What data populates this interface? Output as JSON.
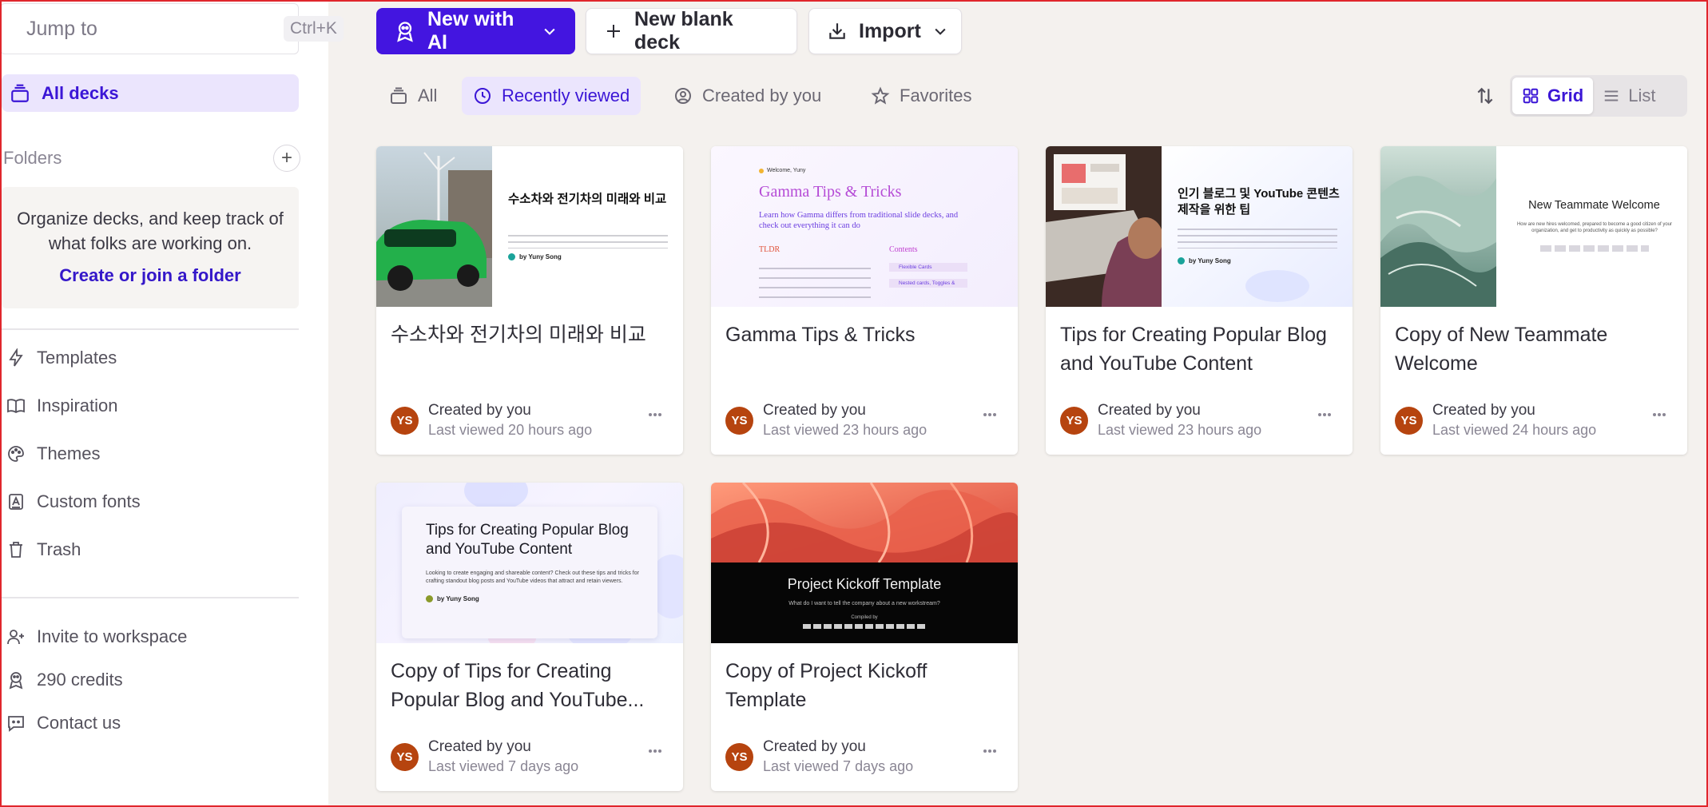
{
  "sidebar": {
    "search": {
      "placeholder": "Jump to",
      "shortcut": "Ctrl+K"
    },
    "all_decks": "All decks",
    "folders_label": "Folders",
    "folders_add": "+",
    "folder_desc": "Organize decks, and keep track of what folks are working on.",
    "folder_link": "Create or join a folder",
    "menu": [
      {
        "label": "Templates",
        "icon": "lightning-icon"
      },
      {
        "label": "Inspiration",
        "icon": "book-icon"
      },
      {
        "label": "Themes",
        "icon": "palette-icon"
      },
      {
        "label": "Custom fonts",
        "icon": "font-icon"
      },
      {
        "label": "Trash",
        "icon": "trash-icon"
      }
    ],
    "bottom": [
      {
        "label": "Invite to workspace",
        "icon": "user-plus-icon"
      },
      {
        "label": "290 credits",
        "icon": "credits-icon"
      },
      {
        "label": "Contact us",
        "icon": "chat-icon"
      }
    ]
  },
  "toolbar": {
    "new_ai": "New with AI",
    "new_blank": "New blank deck",
    "import": "Import"
  },
  "filters": [
    {
      "label": "All",
      "active": false
    },
    {
      "label": "Recently viewed",
      "active": true
    },
    {
      "label": "Created by you",
      "active": false
    },
    {
      "label": "Favorites",
      "active": false
    }
  ],
  "view": {
    "grid": "Grid",
    "list": "List",
    "selected": "Grid"
  },
  "colors": {
    "accent": "#4315e0",
    "accent_light": "#ebe5fd",
    "avatar": "#b6440f"
  },
  "cards": [
    {
      "title": "수소차와 전기차의 미래와 비교",
      "creator": "Created by you",
      "viewed": "Last viewed 20 hours ago",
      "avatar": "YS",
      "thumb": {
        "heading": "수소차와 전기차의 미래와 비교",
        "author": "by Yuny Song"
      }
    },
    {
      "title": "Gamma Tips & Tricks",
      "creator": "Created by you",
      "viewed": "Last viewed 23 hours ago",
      "avatar": "YS",
      "thumb": {
        "welcome": "Welcome, Yuny",
        "heading": "Gamma Tips & Tricks",
        "sub": "Learn how Gamma differs from traditional slide decks, and check out everything it can do",
        "col1": "TLDR",
        "col2": "Contents",
        "item1": "Flexible Cards",
        "item2": "Nested cards, Toggles &"
      }
    },
    {
      "title": "Tips for Creating Popular Blog and YouTube Content",
      "creator": "Created by you",
      "viewed": "Last viewed 23 hours ago",
      "avatar": "YS",
      "thumb": {
        "heading": "인기 블로그 및 YouTube 콘텐츠 제작을 위한 팁",
        "author": "by Yuny Song"
      }
    },
    {
      "title": "Copy of New Teammate Welcome",
      "creator": "Created by you",
      "viewed": "Last viewed 24 hours ago",
      "avatar": "YS",
      "thumb": {
        "heading": "New Teammate Welcome",
        "sub": "How are new hires welcomed, prepared to become a good citizen of your organization, and get to productivity as quickly as possible?"
      }
    },
    {
      "title": "Copy of Tips for Creating Popular Blog and YouTube...",
      "creator": "Created by you",
      "viewed": "Last viewed 7 days ago",
      "avatar": "YS",
      "thumb": {
        "heading": "Tips for Creating Popular Blog and YouTube Content",
        "sub": "Looking to create engaging and shareable content? Check out these tips and tricks for crafting standout blog posts and YouTube videos that attract and retain viewers.",
        "author": "by Yuny Song"
      }
    },
    {
      "title": "Copy of Project Kickoff Template",
      "creator": "Created by you",
      "viewed": "Last viewed 7 days ago",
      "avatar": "YS",
      "thumb": {
        "heading": "Project Kickoff Template",
        "sub": "What do I want to tell the company about a new workstream?",
        "by": "Compiled by"
      }
    }
  ]
}
